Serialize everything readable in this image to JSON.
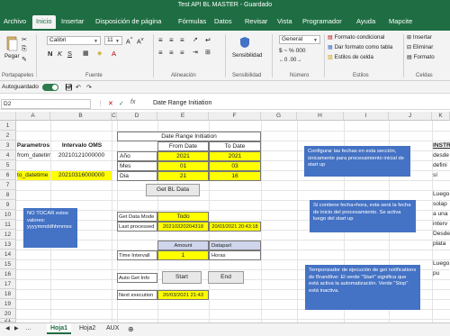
{
  "window": {
    "title": "Test API BL MASTER - Guardado"
  },
  "tabs": [
    "Archivo",
    "Inicio",
    "Insertar",
    "Disposición de página",
    "Fórmulas",
    "Datos",
    "Revisar",
    "Vista",
    "Programador",
    "Ayuda",
    "Mapcite"
  ],
  "ribbon": {
    "paste_label": "Pegar",
    "clipboard_label": "Portapapeles",
    "font_name": "Calibri",
    "font_size": "11",
    "font_label": "Fuente",
    "alignment_label": "Alineación",
    "sensitivity_label": "Sensibilidad",
    "sensitivity_group": "Sensibilidad",
    "number_format": "General",
    "number_label": "Número",
    "styles": {
      "conditional": "Formato condicional",
      "table": "Dar formato como tabla",
      "cell_styles": "Estilos de celda",
      "label": "Estilos"
    },
    "cells": {
      "insert": "Insertar",
      "delete": "Eliminar",
      "format": "Formato",
      "label": "Celdas"
    }
  },
  "qat": {
    "autosave": "Autoguardado"
  },
  "formula_bar": {
    "name_box": "D2",
    "fx": "fx",
    "content": "Date Range Initiation"
  },
  "columns": [
    "A",
    "B",
    "C",
    "D",
    "E",
    "F",
    "G",
    "H",
    "I",
    "J",
    "K"
  ],
  "rows": [
    "1",
    "2",
    "3",
    "4",
    "5",
    "6",
    "7",
    "8",
    "9",
    "10",
    "11",
    "12",
    "13",
    "14",
    "15",
    "16",
    "17",
    "18",
    "19",
    "20",
    "21"
  ],
  "cells": {
    "a3": "Parametros",
    "b3": "Intervalo OMS",
    "a4": "from_datetime",
    "b4": "20210121000000",
    "a6": "to_datetime",
    "b6": "20210316000000",
    "d2": "Date Range Initiation",
    "e3": "From Date",
    "f3": "To Date",
    "d4": "Año",
    "e4": "2021",
    "f4": "2021",
    "d5": "Mes",
    "e5": "01",
    "f5": "03",
    "d6": "Dia",
    "e6": "21",
    "f6": "16",
    "get_bl_data": "Get BL Data",
    "d11": "Get Data Mode",
    "e11": "Todo",
    "d12": "Last processed",
    "e12": "20210320204318",
    "f12": "20/03/2021 20:43:18",
    "e14": "Amount",
    "f14": "Dataparl",
    "d15": "Time Intervall",
    "e15": "1",
    "f15": "Horas",
    "d18": "Auto Get Info",
    "start": "Start",
    "end": "End",
    "d20": "Next execution",
    "e20": "20/03/2021 21:43",
    "k_lines": [
      "INSTR",
      "desde",
      "defini",
      "sí",
      "Luego",
      "solap",
      "a una",
      "interv",
      "Desde",
      "plata",
      "Luego",
      "pu"
    ]
  },
  "callouts": {
    "left": "NO TOCAR estos valores: yyyymmddhhmmss",
    "c1": "Configurar las fechas en esta sección, únicamente para procesamiento inicial de start up",
    "c2": "Si contiene fecha+hora, esta será la fecha de inicio del procesamiento. Se activa luego del start up",
    "c3": "Temporizador de ejecución de get notifications de Brandlive: El verde \"Start\" significa que está activa la automatización. Verde \"Stop\" está inactiva."
  },
  "sheets": [
    "Hoja1",
    "Hoja2",
    "AUX"
  ],
  "colors": {
    "excel_green": "#1f6e43",
    "callout_blue": "#4472c4",
    "yellow": "#ffff00",
    "green_button": "#92d050"
  }
}
